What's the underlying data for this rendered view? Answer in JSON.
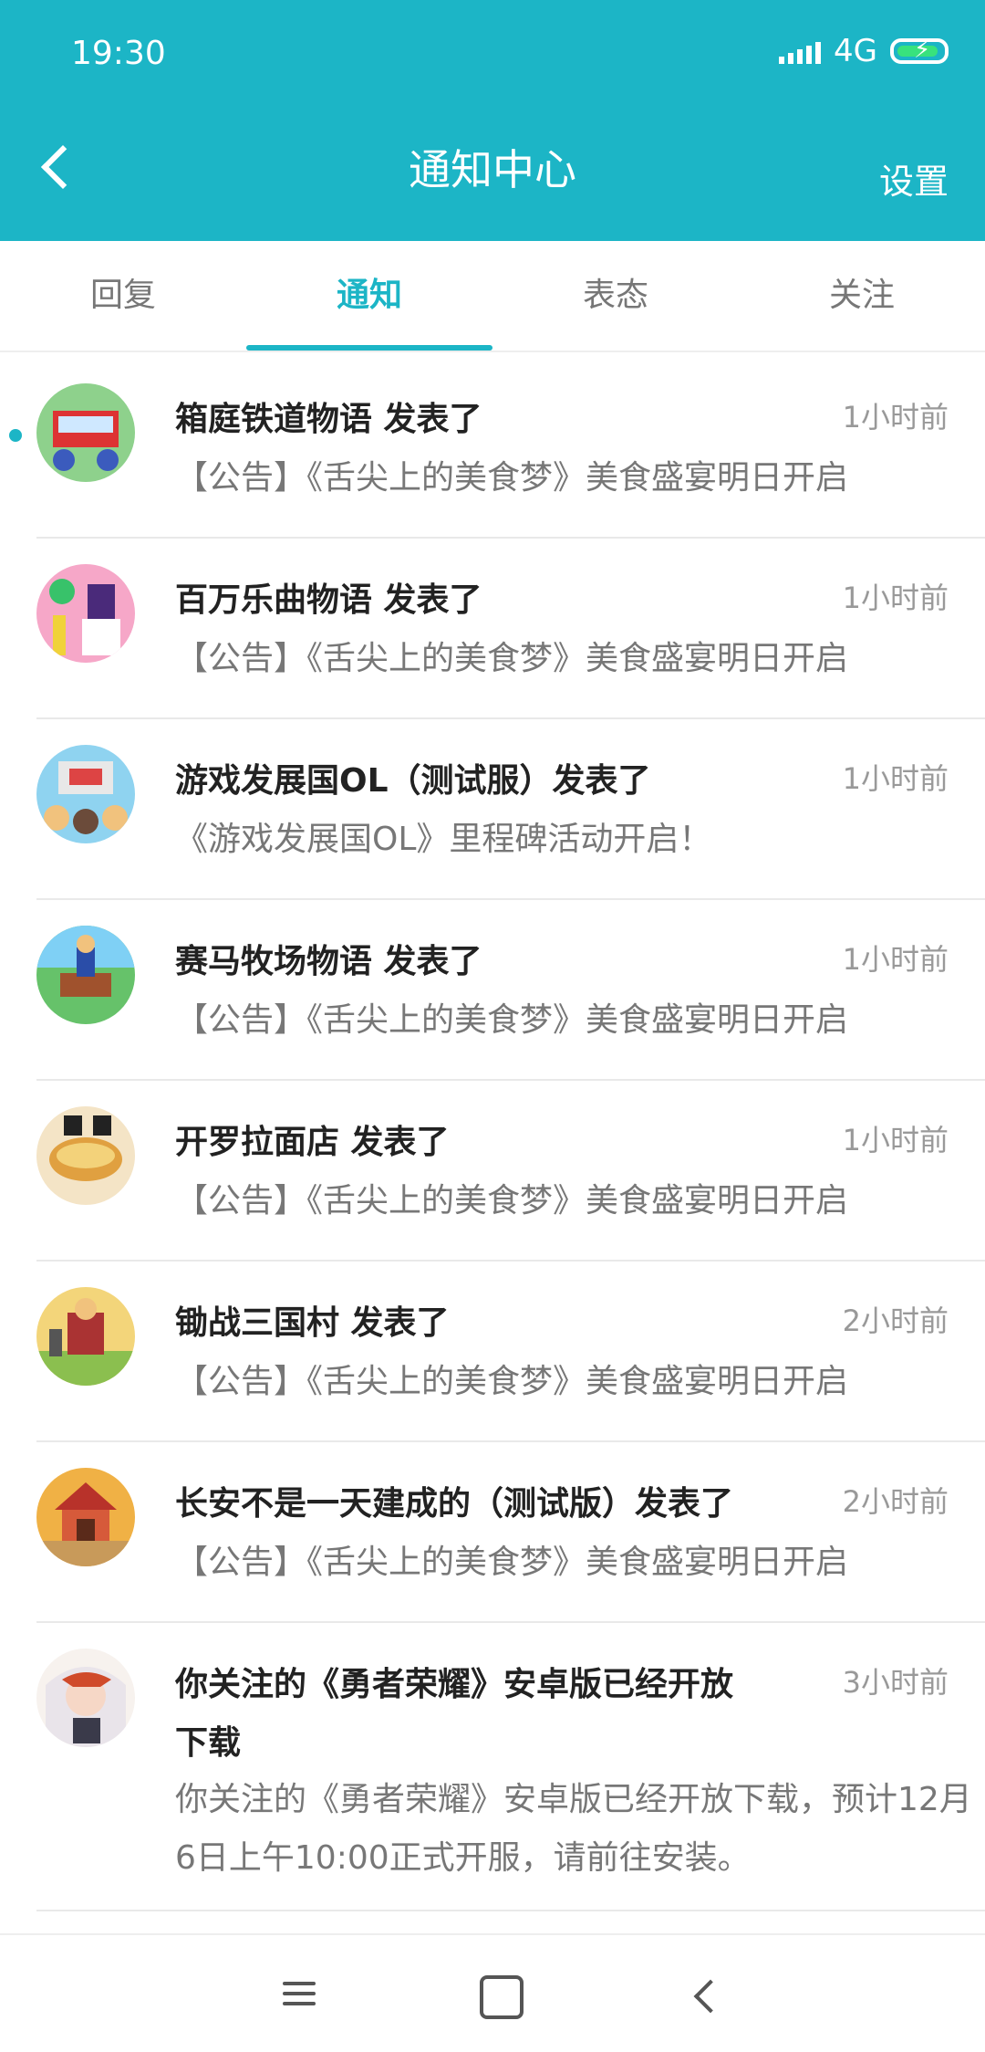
{
  "status_bar": {
    "time": "19:30",
    "network": "4G"
  },
  "header": {
    "title": "通知中心",
    "settings_label": "设置"
  },
  "tabs": [
    {
      "label": "回复"
    },
    {
      "label": "通知",
      "active": true
    },
    {
      "label": "表态"
    },
    {
      "label": "关注"
    }
  ],
  "notifications": [
    {
      "title": "箱庭铁道物语 发表了",
      "time": "1小时前",
      "text": "【公告】《舌尖上的美食梦》美食盛宴明日开启",
      "unread": true
    },
    {
      "title": "百万乐曲物语 发表了",
      "time": "1小时前",
      "text": "【公告】《舌尖上的美食梦》美食盛宴明日开启"
    },
    {
      "title": "游戏发展国OL（测试服）发表了",
      "time": "1小时前",
      "text": "《游戏发展国OL》里程碑活动开启！"
    },
    {
      "title": "赛马牧场物语 发表了",
      "time": "1小时前",
      "text": "【公告】《舌尖上的美食梦》美食盛宴明日开启"
    },
    {
      "title": "开罗拉面店 发表了",
      "time": "1小时前",
      "text": "【公告】《舌尖上的美食梦》美食盛宴明日开启"
    },
    {
      "title": "锄战三国村 发表了",
      "time": "2小时前",
      "text": "【公告】《舌尖上的美食梦》美食盛宴明日开启"
    },
    {
      "title": "长安不是一天建成的（测试版）发表了",
      "time": "2小时前",
      "text": "【公告】《舌尖上的美食梦》美食盛宴明日开启"
    },
    {
      "title": "你关注的《勇者荣耀》安卓版已经开放下载",
      "time": "3小时前",
      "text": "你关注的《勇者荣耀》安卓版已经开放下载，预计12月6日上午10:00正式开服，请前往安装。"
    }
  ],
  "colors": {
    "accent": "#1cb5c6"
  }
}
